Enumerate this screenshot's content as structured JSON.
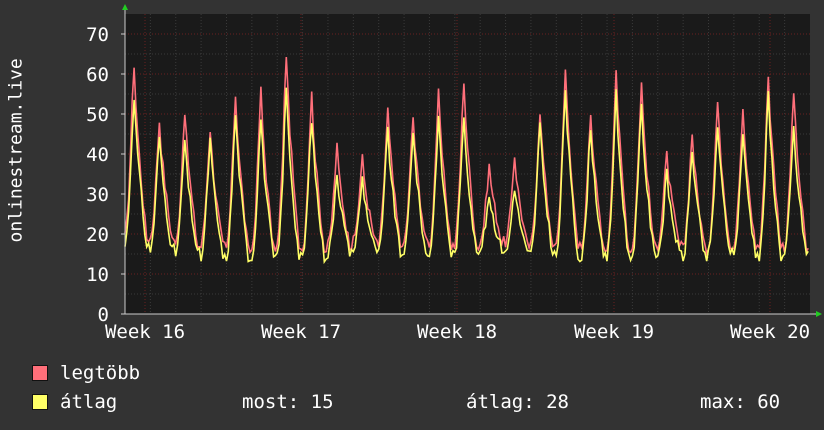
{
  "colors": {
    "background": "#333333",
    "plot": "#1a1a1a",
    "grid": "#6b2020",
    "grid_minor": "#3a3a3a",
    "series_max": "#ff6f7a",
    "series_avg": "#ffff66",
    "axis": "#ffffff"
  },
  "chart_data": {
    "type": "line",
    "ylabel": "onlinestream.live",
    "ylim": [
      0,
      75
    ],
    "yticks": [
      0,
      10,
      20,
      30,
      40,
      50,
      60,
      70
    ],
    "xticks": [
      "Week 16",
      "Week 17",
      "Week 18",
      "Week 19",
      "Week 20"
    ],
    "grid": true,
    "series": [
      {
        "name": "legtöbb",
        "color": "#ff6f7a",
        "daily_peaks": [
          65,
          50,
          53,
          48,
          57,
          58,
          68,
          57,
          43,
          40,
          53,
          51,
          57,
          61,
          38,
          41,
          53,
          63,
          53,
          64,
          60,
          41,
          47,
          55,
          52,
          62,
          58
        ],
        "daily_mins": [
          19,
          19,
          17,
          17,
          16,
          16,
          17,
          16,
          17,
          18,
          17,
          18,
          17,
          17,
          18,
          17,
          17,
          17,
          16,
          16,
          17,
          17,
          16,
          17,
          17,
          17,
          16
        ]
      },
      {
        "name": "átlag",
        "color": "#ffff66",
        "daily_peaks": [
          57,
          46,
          45,
          45,
          52,
          51,
          59,
          51,
          37,
          35,
          48,
          48,
          51,
          52,
          31,
          33,
          49,
          59,
          49,
          57,
          54,
          36,
          43,
          49,
          47,
          57,
          48
        ],
        "daily_mins": [
          17,
          16,
          15,
          14,
          14,
          14,
          14,
          14,
          15,
          16,
          15,
          15,
          15,
          15,
          16,
          15,
          15,
          14,
          14,
          14,
          15,
          15,
          14,
          15,
          15,
          14,
          15
        ]
      }
    ]
  },
  "legend": [
    {
      "label": "legtöbb",
      "color": "#ff6f7a"
    },
    {
      "label": "átlag",
      "color": "#ffff66"
    }
  ],
  "stats": {
    "most": "most: 15",
    "atlag": "átlag: 28",
    "max": "max: 60"
  }
}
